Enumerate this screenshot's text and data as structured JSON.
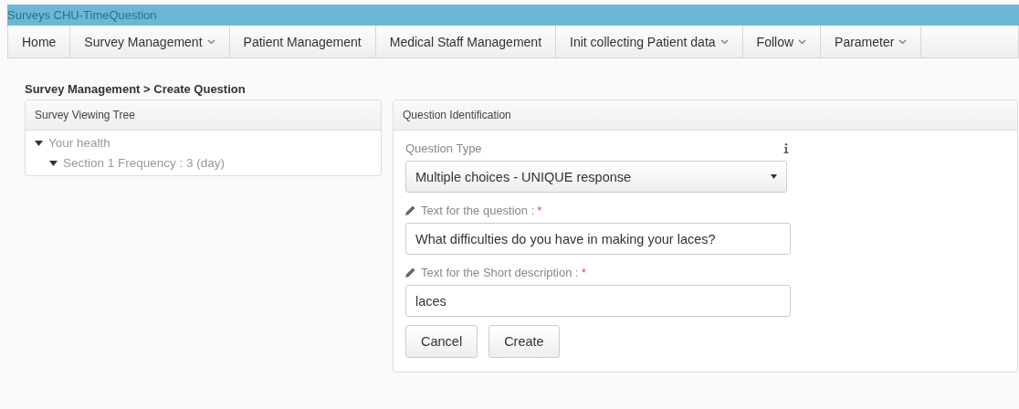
{
  "window": {
    "title": "Surveys CHU-TimeQuestion"
  },
  "nav": [
    {
      "label": "Home",
      "dropdown": false
    },
    {
      "label": "Survey Management",
      "dropdown": true
    },
    {
      "label": "Patient Management",
      "dropdown": false
    },
    {
      "label": "Medical Staff Management",
      "dropdown": false
    },
    {
      "label": "Init collecting Patient data",
      "dropdown": true
    },
    {
      "label": "Follow",
      "dropdown": true
    },
    {
      "label": "Parameter",
      "dropdown": true
    }
  ],
  "breadcrumb": "Survey Management > Create Question",
  "tree_panel": {
    "title": "Survey Viewing Tree",
    "items": [
      {
        "label": "Your health",
        "expanded": true,
        "children": [
          {
            "label": "Section 1 Frequency : 3 (day)",
            "expanded": true
          }
        ]
      }
    ]
  },
  "form_panel": {
    "title": "Question Identification",
    "question_type": {
      "label": "Question Type",
      "value": "Multiple choices - UNIQUE response"
    },
    "fields": [
      {
        "label": "Text for the question :",
        "required_mark": "*",
        "value": "What difficulties do you have in making your laces?"
      },
      {
        "label": "Text for the Short description :",
        "required_mark": "*",
        "value": "laces"
      }
    ],
    "buttons": [
      "Cancel",
      "Create"
    ]
  }
}
